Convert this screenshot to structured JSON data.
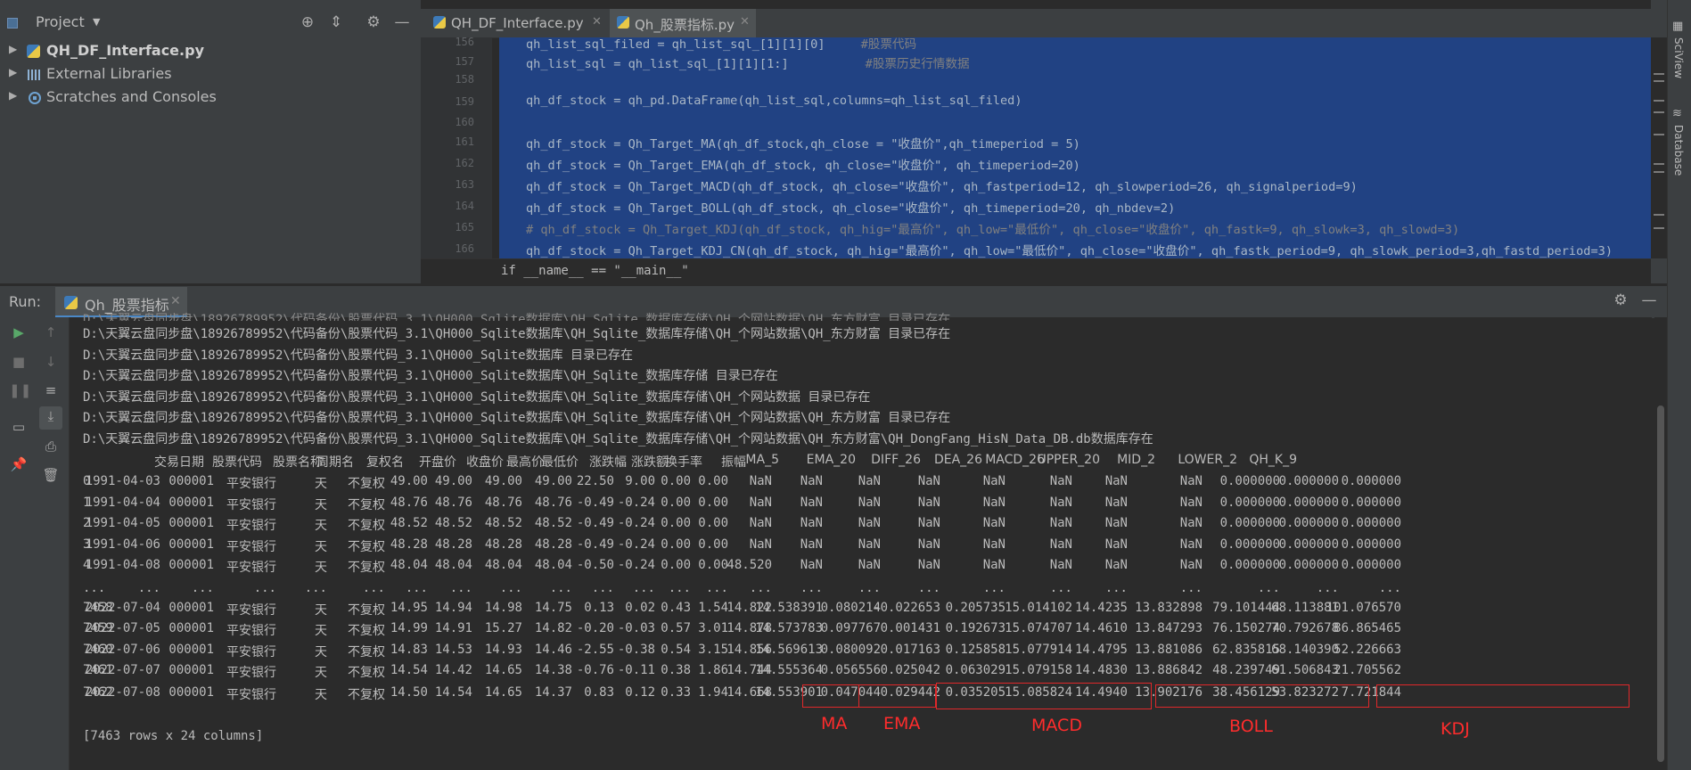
{
  "project_panel": {
    "title": "Project",
    "tree": [
      {
        "label": "QH_DF_Interface.py",
        "icon": "python-file-icon",
        "bold": true
      },
      {
        "label": "External Libraries",
        "icon": "libraries-icon",
        "bold": false
      },
      {
        "label": "Scratches and Consoles",
        "icon": "scratches-icon",
        "bold": false
      }
    ]
  },
  "editor": {
    "tabs": [
      {
        "label": "QH_DF_Interface.py",
        "active": false
      },
      {
        "label": "Qh_股票指标.py",
        "active": true
      }
    ],
    "lines": [
      {
        "num": "156",
        "text": "qh_list_sql_filed = qh_list_sql_[1][1][0]",
        "comment": "#股票代码"
      },
      {
        "num": "157",
        "text": "qh_list_sql = qh_list_sql_[1][1][1:]",
        "comment": "#股票历史行情数据"
      },
      {
        "num": "158",
        "text": "",
        "comment": ""
      },
      {
        "num": "159",
        "text": "qh_df_stock = qh_pd.DataFrame(qh_list_sql,columns=qh_list_sql_filed)",
        "comment": ""
      },
      {
        "num": "160",
        "text": "",
        "comment": ""
      },
      {
        "num": "161",
        "text": "qh_df_stock = Qh_Target_MA(qh_df_stock,qh_close = \"收盘价\",qh_timeperiod = 5)",
        "comment": ""
      },
      {
        "num": "162",
        "text": "qh_df_stock = Qh_Target_EMA(qh_df_stock, qh_close=\"收盘价\", qh_timeperiod=20)",
        "comment": ""
      },
      {
        "num": "163",
        "text": "qh_df_stock = Qh_Target_MACD(qh_df_stock, qh_close=\"收盘价\", qh_fastperiod=12, qh_slowperiod=26, qh_signalperiod=9)",
        "comment": ""
      },
      {
        "num": "164",
        "text": "qh_df_stock = Qh_Target_BOLL(qh_df_stock, qh_close=\"收盘价\", qh_timeperiod=20, qh_nbdev=2)",
        "comment": ""
      },
      {
        "num": "165",
        "text": "# qh_df_stock = Qh_Target_KDJ(qh_df_stock, qh_hig=\"最高价\", qh_low=\"最低价\", qh_close=\"收盘价\", qh_fastk=9, qh_slowk=3, qh_slowd=3)",
        "comment": ""
      },
      {
        "num": "166",
        "text": "qh_df_stock = Qh_Target_KDJ_CN(qh_df_stock, qh_hig=\"最高价\", qh_low=\"最低价\", qh_close=\"收盘价\", qh_fastk_period=9, qh_slowk_period=3,qh_fastd_period=3)",
        "comment": ""
      }
    ],
    "status_line": "if __name__ == \"__main__\""
  },
  "right_strip": {
    "items": [
      "SciView",
      "Database"
    ]
  },
  "run": {
    "label": "Run:",
    "tab": "Qh_股票指标",
    "log_lines": [
      "D:\\天翼云盘同步盘\\18926789952\\代码备份\\股票代码_3.1\\QH000_Sqlite数据库\\QH_Sqlite_数据库存储\\QH_个网站数据\\QH_东方财富 目录已存在",
      "D:\\天翼云盘同步盘\\18926789952\\代码备份\\股票代码_3.1\\QH000_Sqlite数据库 目录已存在",
      "D:\\天翼云盘同步盘\\18926789952\\代码备份\\股票代码_3.1\\QH000_Sqlite数据库\\QH_Sqlite_数据库存储 目录已存在",
      "D:\\天翼云盘同步盘\\18926789952\\代码备份\\股票代码_3.1\\QH000_Sqlite数据库\\QH_Sqlite_数据库存储\\QH_个网站数据 目录已存在",
      "D:\\天翼云盘同步盘\\18926789952\\代码备份\\股票代码_3.1\\QH000_Sqlite数据库\\QH_Sqlite_数据库存储\\QH_个网站数据\\QH_东方财富 目录已存在",
      "D:\\天翼云盘同步盘\\18926789952\\代码备份\\股票代码_3.1\\QH000_Sqlite数据库\\QH_Sqlite_数据库存储\\QH_个网站数据\\QH_东方财富\\QH_DongFang_HisN_Data_DB.db数据库存在"
    ],
    "table": {
      "columns": [
        "交易日期",
        "股票代码",
        "股票名称",
        "周期名",
        "复权名",
        "开盘价",
        "收盘价",
        "最高价",
        "最低价",
        "涨跌幅",
        "涨跌额",
        "换手率",
        "振幅",
        "MA_5",
        "EMA_20",
        "DIFF_26",
        "DEA_26",
        "MACD_26",
        "UPPER_20",
        "MID_2",
        "LOWER_2",
        "QH_K_9"
      ],
      "rows": [
        [
          "0",
          "1991-04-03",
          "000001",
          "平安银行",
          "天",
          "不复权",
          "49.00",
          "49.00",
          "49.00",
          "49.00",
          "22.50",
          "9.00",
          "0.00",
          "0.00",
          "NaN",
          "NaN",
          "NaN",
          "NaN",
          "NaN",
          "NaN",
          "NaN",
          "NaN",
          "0.000000",
          "0.000000",
          "0.000000"
        ],
        [
          "1",
          "1991-04-04",
          "000001",
          "平安银行",
          "天",
          "不复权",
          "48.76",
          "48.76",
          "48.76",
          "48.76",
          "-0.49",
          "-0.24",
          "0.00",
          "0.00",
          "NaN",
          "NaN",
          "NaN",
          "NaN",
          "NaN",
          "NaN",
          "NaN",
          "NaN",
          "0.000000",
          "0.000000",
          "0.000000"
        ],
        [
          "2",
          "1991-04-05",
          "000001",
          "平安银行",
          "天",
          "不复权",
          "48.52",
          "48.52",
          "48.52",
          "48.52",
          "-0.49",
          "-0.24",
          "0.00",
          "0.00",
          "NaN",
          "NaN",
          "NaN",
          "NaN",
          "NaN",
          "NaN",
          "NaN",
          "NaN",
          "0.000000",
          "0.000000",
          "0.000000"
        ],
        [
          "3",
          "1991-04-06",
          "000001",
          "平安银行",
          "天",
          "不复权",
          "48.28",
          "48.28",
          "48.28",
          "48.28",
          "-0.49",
          "-0.24",
          "0.00",
          "0.00",
          "NaN",
          "NaN",
          "NaN",
          "NaN",
          "NaN",
          "NaN",
          "NaN",
          "NaN",
          "0.000000",
          "0.000000",
          "0.000000"
        ],
        [
          "4",
          "1991-04-08",
          "000001",
          "平安银行",
          "天",
          "不复权",
          "48.04",
          "48.04",
          "48.04",
          "48.04",
          "-0.50",
          "-0.24",
          "0.00",
          "0.00",
          "48.520",
          "NaN",
          "NaN",
          "NaN",
          "NaN",
          "NaN",
          "NaN",
          "NaN",
          "0.000000",
          "0.000000",
          "0.000000"
        ],
        [
          "...",
          "...",
          "...",
          "...",
          "...",
          "...",
          "...",
          "...",
          "...",
          "...",
          "...",
          "...",
          "...",
          "...",
          "...",
          "...",
          "...",
          "...",
          "...",
          "...",
          "...",
          "...",
          "...",
          "...",
          "..."
        ],
        [
          "7458",
          "2022-07-04",
          "000001",
          "平安银行",
          "天",
          "不复权",
          "14.95",
          "14.94",
          "14.98",
          "14.75",
          "0.13",
          "0.02",
          "0.43",
          "1.54",
          "14.822",
          "14.538391",
          "0.080214",
          "-0.022653",
          "0.205735",
          "15.014102",
          "14.4235",
          "13.832898",
          "79.101444",
          "68.113881",
          "101.076570"
        ],
        [
          "7459",
          "2022-07-05",
          "000001",
          "平安银行",
          "天",
          "不复权",
          "14.99",
          "14.91",
          "15.27",
          "14.82",
          "-0.20",
          "-0.03",
          "0.57",
          "3.01",
          "14.878",
          "14.573783",
          "0.097767",
          "0.001431",
          "0.192673",
          "15.074707",
          "14.4610",
          "13.847293",
          "76.150274",
          "70.792678",
          "86.865465"
        ],
        [
          "7460",
          "2022-07-06",
          "000001",
          "平安银行",
          "天",
          "不复权",
          "14.83",
          "14.53",
          "14.93",
          "14.46",
          "-2.55",
          "-0.38",
          "0.54",
          "3.15",
          "14.856",
          "14.569613",
          "0.080092",
          "0.017163",
          "0.125858",
          "15.077914",
          "14.4795",
          "13.881086",
          "62.835815",
          "68.140390",
          "52.226663"
        ],
        [
          "7461",
          "2022-07-07",
          "000001",
          "平安银行",
          "天",
          "不复权",
          "14.54",
          "14.42",
          "14.65",
          "14.38",
          "-0.76",
          "-0.11",
          "0.38",
          "1.86",
          "14.744",
          "14.555364",
          "0.056556",
          "0.025042",
          "0.063029",
          "15.079158",
          "14.4830",
          "13.886842",
          "48.239749",
          "61.506843",
          "21.705562"
        ],
        [
          "7462",
          "2022-07-08",
          "000001",
          "平安银行",
          "天",
          "不复权",
          "14.50",
          "14.54",
          "14.65",
          "14.37",
          "0.83",
          "0.12",
          "0.33",
          "1.94",
          "14.668",
          "14.553901",
          "0.047044",
          "0.029442",
          "0.035205",
          "15.085824",
          "14.4940",
          "13.902176",
          "38.456129",
          "53.823272",
          "7.721844"
        ]
      ],
      "summary": "[7463 rows x 24 columns]"
    },
    "annotations": [
      "MA",
      "EMA",
      "MACD",
      "BOLL",
      "KDJ"
    ],
    "annotation_color": "#e0282a"
  }
}
